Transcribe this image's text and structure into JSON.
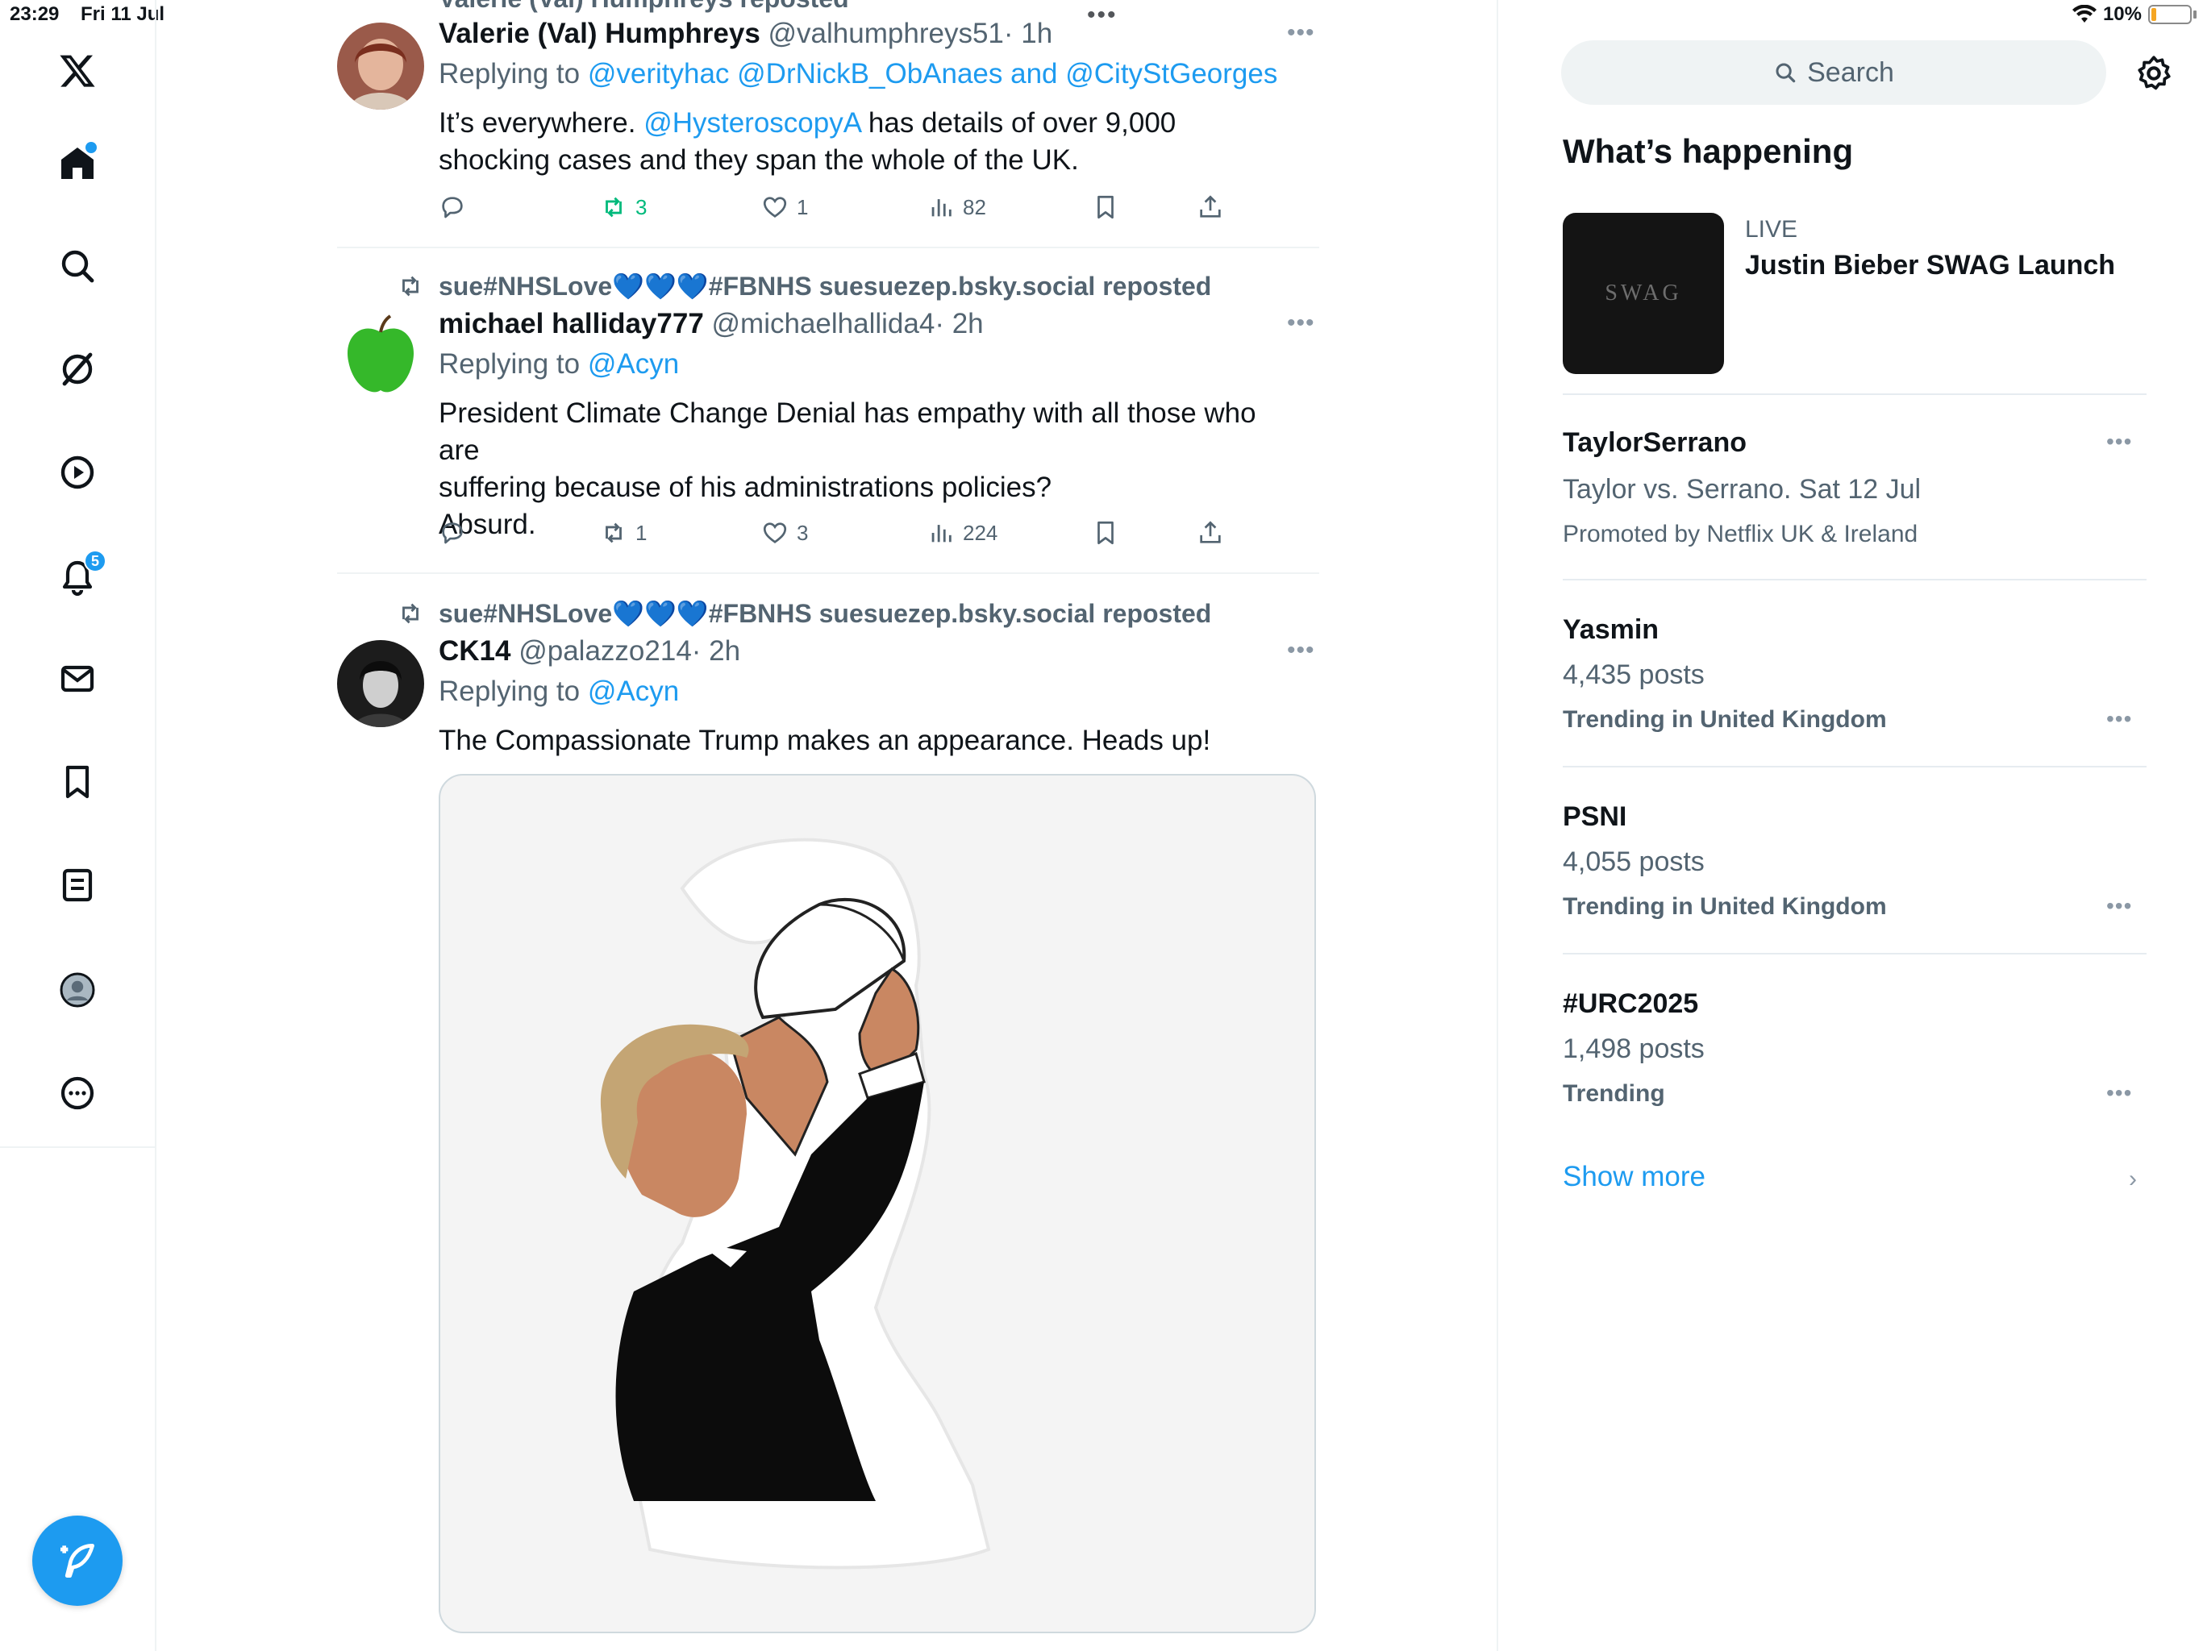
{
  "status_bar": {
    "time": "23:29",
    "date": "Fri 11 Jul",
    "battery": "10%",
    "top_dots": "•••"
  },
  "nav": {
    "notifications_badge": "5",
    "items": [
      "x-logo-icon",
      "home-icon",
      "search-icon",
      "grok-icon",
      "video-icon",
      "bell-icon",
      "mail-icon",
      "bookmark-icon",
      "lists-icon",
      "profile-icon",
      "more-icon"
    ]
  },
  "timeline": {
    "top_cut_repost": "Valerie (Val) Humphreys reposted",
    "tweets": [
      {
        "name": "Valerie (Val) Humphreys",
        "handle": "@valhumphreys51",
        "time": "· 1h",
        "replying_prefix": "Replying to",
        "replying_to": "@verityhac @DrNickB_ObAnaes and @CityStGeorges",
        "body_pre": "It’s everywhere.",
        "body_link": "@HysteroscopyA",
        "body_post": "has details of over 9,000 shocking cases and they span the whole of the UK.",
        "reposts": "3",
        "likes": "1",
        "views": "82"
      },
      {
        "repost_line": "sue#NHSLove💙💙💙#FBNHS suesuezep.bsky.social reposted",
        "name": "michael halliday777",
        "handle": "@michaelhallida4",
        "time": "· 2h",
        "replying_prefix": "Replying to",
        "replying_to": "@Acyn",
        "body_lines": [
          "President Climate Change Denial has empathy with all those who are",
          "suffering because of his administrations policies?",
          "Absurd."
        ],
        "reposts": "1",
        "likes": "3",
        "views": "224"
      },
      {
        "repost_line": "sue#NHSLove💙💙💙#FBNHS suesuezep.bsky.social reposted",
        "name": "CK14",
        "handle": "@palazzo214",
        "time": "· 2h",
        "replying_prefix": "Replying to",
        "replying_to": "@Acyn",
        "body": "The Compassionate Trump makes an appearance. Heads up!"
      }
    ]
  },
  "sidebar": {
    "search_placeholder": "Search",
    "whats_happening": "What’s happening",
    "live": {
      "label": "LIVE",
      "title": "Justin Bieber SWAG Launch",
      "thumb_text": "SWAG"
    },
    "trends": [
      {
        "title": "TaylorSerrano",
        "sub": "Taylor vs. Serrano. Sat 12 Jul",
        "meta": "Promoted by Netflix UK & Ireland"
      },
      {
        "title": "Yasmin",
        "sub": "4,435 posts",
        "meta": "Trending in United Kingdom"
      },
      {
        "title": "PSNI",
        "sub": "4,055 posts",
        "meta": "Trending in United Kingdom"
      },
      {
        "title": "#URC2025",
        "sub": "1,498 posts",
        "meta": "Trending"
      }
    ],
    "show_more": "Show more"
  },
  "colors": {
    "accent": "#1d9bf0",
    "secondary_text": "#536471",
    "repost_green": "#00ba7c"
  }
}
